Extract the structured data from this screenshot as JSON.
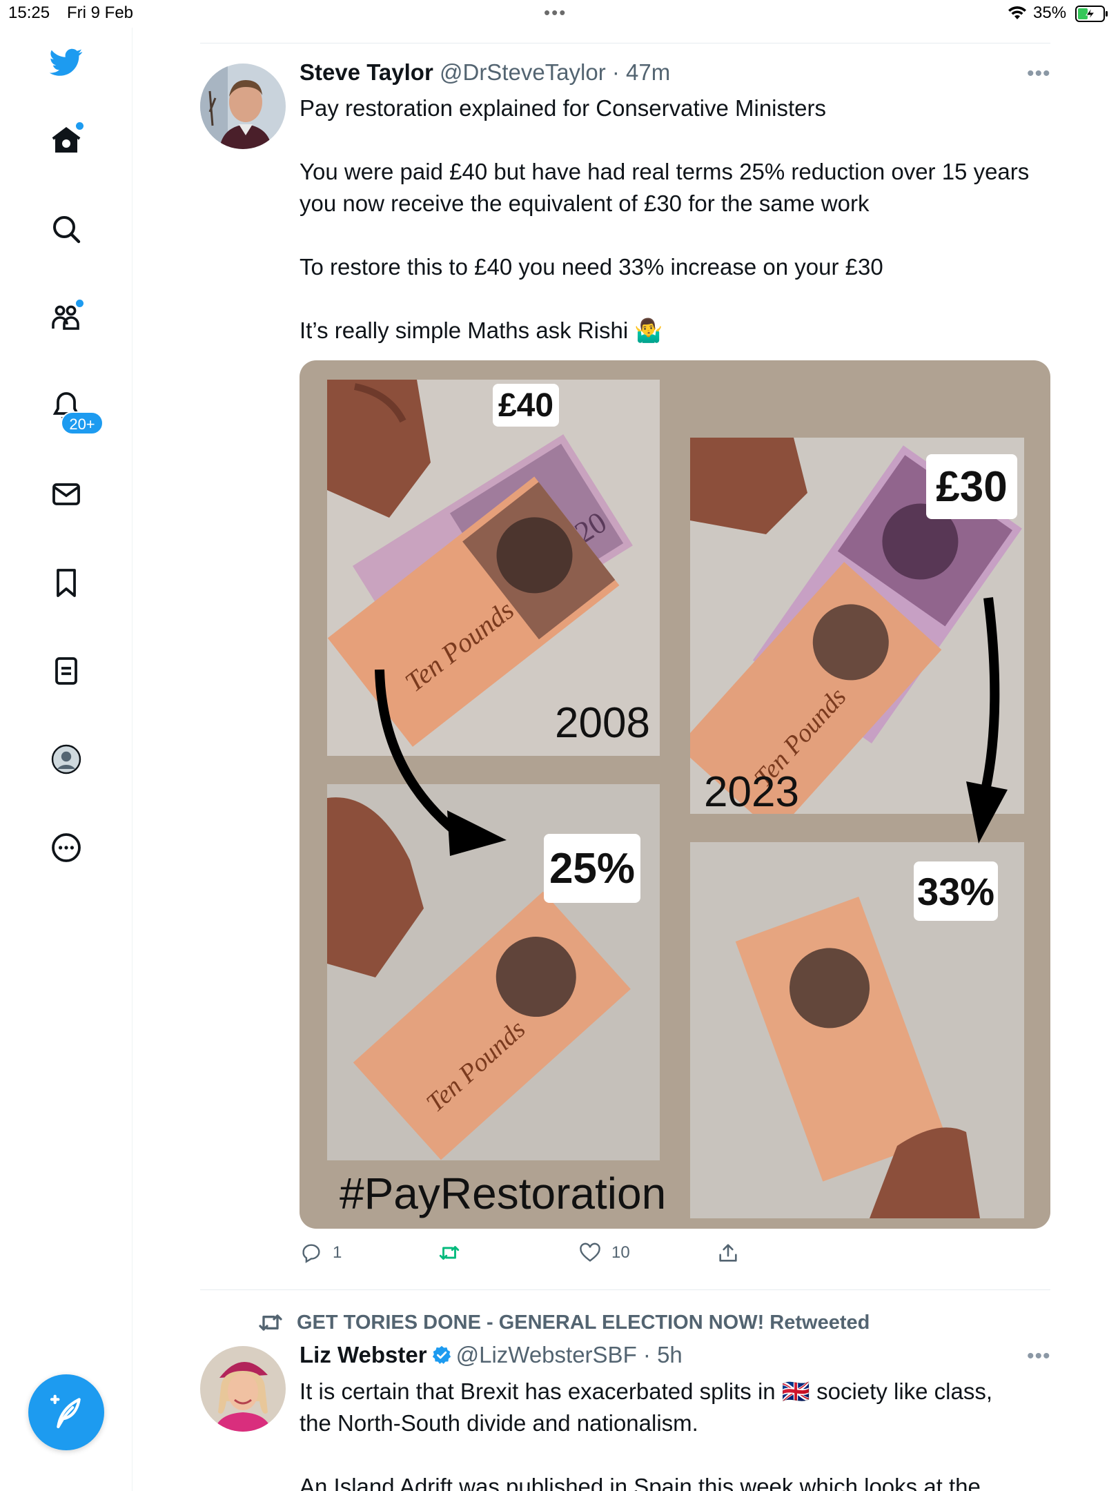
{
  "status_bar": {
    "time": "15:25",
    "date": "Fri 9 Feb",
    "battery": "35%",
    "center_dots": "•••"
  },
  "sidebar": {
    "items": [
      {
        "name": "twitter-logo",
        "icon": "bird-icon"
      },
      {
        "name": "home",
        "icon": "home-icon"
      },
      {
        "name": "explore",
        "icon": "search-icon"
      },
      {
        "name": "communities",
        "icon": "people-icon"
      },
      {
        "name": "notifications",
        "icon": "bell-icon",
        "badge": "20+"
      },
      {
        "name": "messages",
        "icon": "mail-icon"
      },
      {
        "name": "bookmarks",
        "icon": "bookmark-icon"
      },
      {
        "name": "lists",
        "icon": "list-icon"
      },
      {
        "name": "profile",
        "icon": "profile-icon"
      },
      {
        "name": "more",
        "icon": "more-icon"
      }
    ],
    "notifications_badge": "20+",
    "compose_icon": "compose-feather-icon"
  },
  "tweet1": {
    "name": "Steve Taylor",
    "handle": "@DrSteveTaylor",
    "sep": " · ",
    "time": "47m",
    "more": "•••",
    "lines": [
      "Pay restoration explained for Conservative Ministers",
      "You were paid £40 but have had real terms 25% reduction over 15 years",
      "you now receive the equivalent of £30 for the same work",
      "To restore this to £40 you need 33% increase on your £30",
      "It’s really simple Maths ask Rishi 🤷‍♂️"
    ],
    "media": {
      "label_40": "£40",
      "year_2008": "2008",
      "label_30": "£30",
      "year_2023": "2023",
      "label_25": "25%",
      "label_33": "33%",
      "hashtag": "#PayRestoration"
    },
    "actions": {
      "reply_count": "1",
      "retweet_count": "",
      "like_count": "10"
    }
  },
  "tweet2": {
    "retweeted_by": "GET TORIES DONE - GENERAL ELECTION NOW! Retweeted",
    "name": "Liz Webster",
    "handle": "@LizWebsterSBF",
    "sep": " · ",
    "time": "5h",
    "more": "•••",
    "line1_before_flag": "It is certain that Brexit has exacerbated splits in",
    "flag": "🇬🇧",
    "line1_after_flag": "society like class,",
    "line2": "the North-South divide and nationalism.",
    "line3": "An Island Adrift was published in Spain this week which looks at the"
  },
  "colors": {
    "accent": "#1d9bf0",
    "text": "#0f1419",
    "muted": "#536471",
    "retweet_green": "#00ba7c",
    "media_bg": "#b0a292"
  }
}
